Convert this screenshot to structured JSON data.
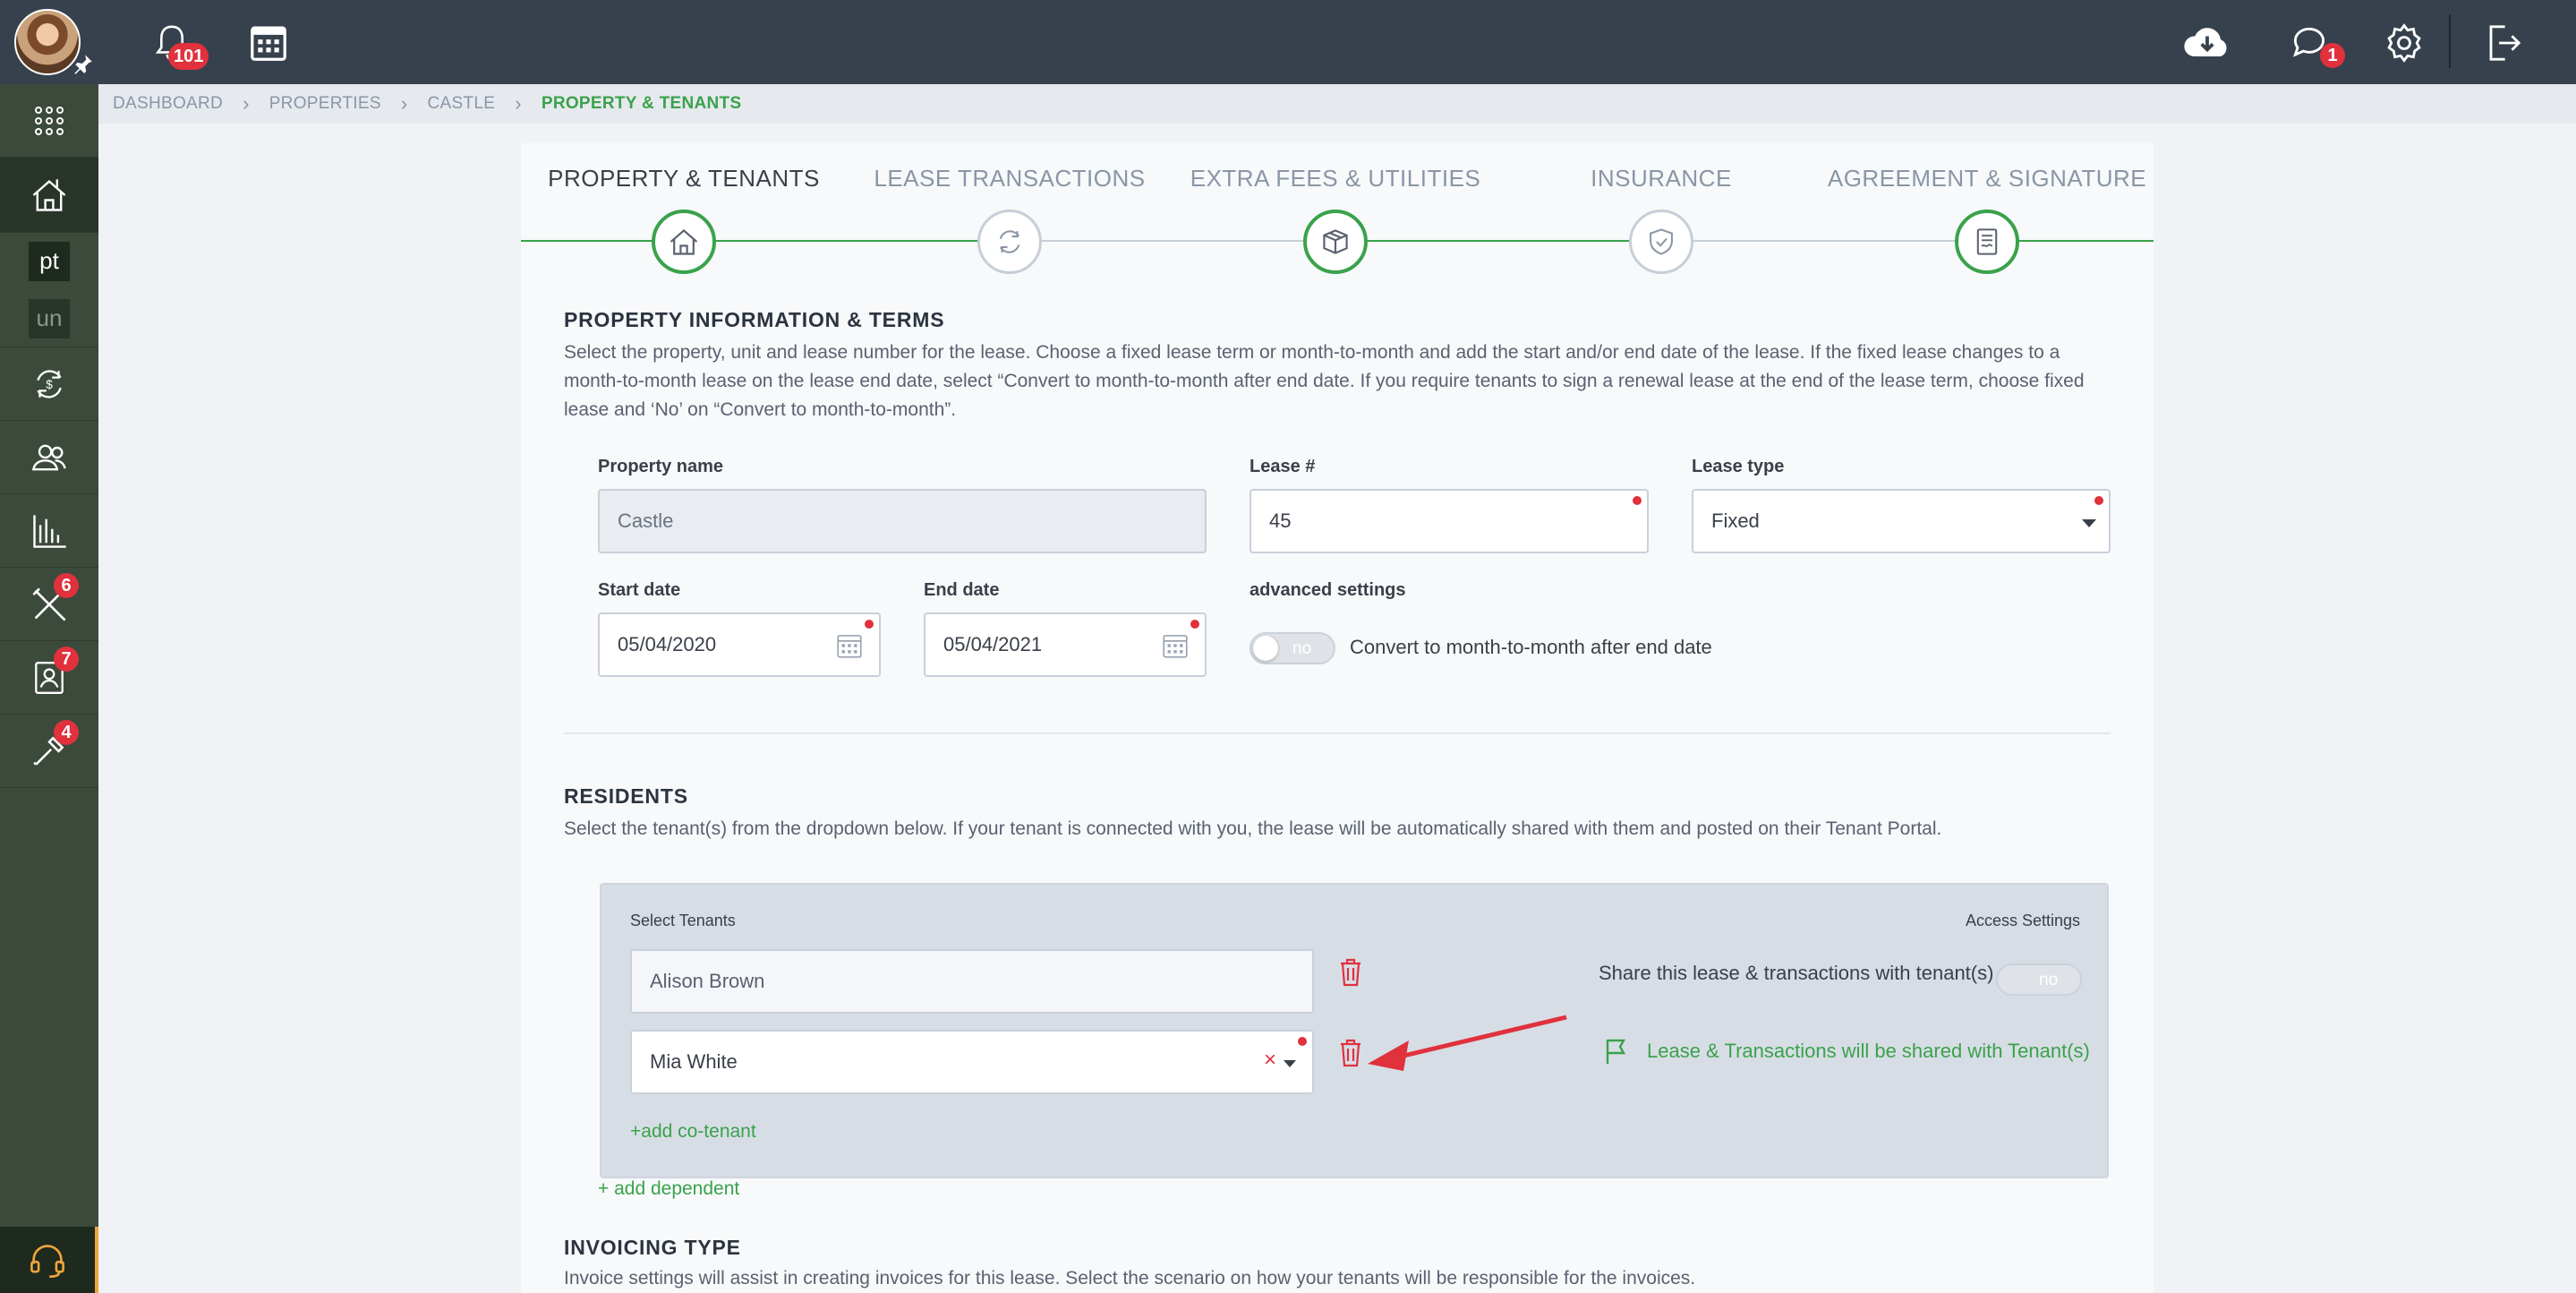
{
  "topbar": {
    "notifications_count": "101",
    "messages_count": "1",
    "icons": [
      "bell-icon",
      "calendar-icon",
      "cloud-download-icon",
      "chat-icon",
      "gear-icon",
      "logout-icon"
    ]
  },
  "sidebar": {
    "items": [
      {
        "icon": "apps-grid-icon"
      },
      {
        "icon": "properties-icon",
        "active": true
      },
      {
        "short": "pt"
      },
      {
        "short": "un"
      },
      {
        "icon": "transactions-icon"
      },
      {
        "icon": "tenants-icon"
      },
      {
        "icon": "reports-icon"
      },
      {
        "icon": "maintenance-icon",
        "badge": "6"
      },
      {
        "icon": "applications-icon",
        "badge": "7"
      },
      {
        "icon": "tools-icon",
        "badge": "4"
      }
    ],
    "support_icon": "headset-icon"
  },
  "breadcrumb": {
    "items": [
      "DASHBOARD",
      "PROPERTIES",
      "CASTLE"
    ],
    "current": "PROPERTY & TENANTS"
  },
  "steps": [
    {
      "label": "PROPERTY & TENANTS",
      "done": true,
      "active": true
    },
    {
      "label": "LEASE TRANSACTIONS",
      "done": false
    },
    {
      "label": "EXTRA FEES & UTILITIES",
      "done": true
    },
    {
      "label": "INSURANCE",
      "done": false
    },
    {
      "label": "AGREEMENT & SIGNATURE",
      "done": true
    }
  ],
  "property_section": {
    "title": "PROPERTY INFORMATION & TERMS",
    "description": "Select the property, unit and lease number for the lease. Choose a fixed lease term or month-to-month and add the start and/or end date of the lease. If the fixed lease changes to a month-to-month lease on the lease end date, select “Convert to month-to-month after end date. If you require tenants to sign a renewal lease at the end of the lease term, choose fixed lease and ‘No’ on “Convert to month-to-month”.",
    "property_name_label": "Property name",
    "property_name_value": "Castle",
    "lease_no_label": "Lease #",
    "lease_no_value": "45",
    "lease_type_label": "Lease type",
    "lease_type_value": "Fixed",
    "start_date_label": "Start date",
    "start_date_value": "05/04/2020",
    "end_date_label": "End date",
    "end_date_value": "05/04/2021",
    "advanced_label": "advanced settings",
    "convert_toggle_text": "no",
    "convert_label": "Convert to month-to-month after end date"
  },
  "residents_section": {
    "title": "RESIDENTS",
    "description": "Select the tenant(s) from the dropdown below. If your tenant is connected with you, the lease will be automatically shared with them and posted on their Tenant Portal.",
    "select_tenants_label": "Select Tenants",
    "access_settings_label": "Access Settings",
    "tenants": [
      "Alison Brown",
      "Mia White"
    ],
    "share_label": "Share this lease & transactions with tenant(s)",
    "share_toggle_text": "no",
    "shared_message": "Lease & Transactions will be shared with Tenant(s)",
    "add_cotenant": "+add co-tenant",
    "add_dependent": "+ add dependent"
  },
  "invoicing_section": {
    "title": "INVOICING TYPE",
    "description": "Invoice settings will assist in creating invoices for this lease. Select the scenario on how your tenants will be responsible for the invoices."
  },
  "colors": {
    "accent_green": "#3aa24b",
    "topbar": "#36414d",
    "sidebar": "#3c4a3c",
    "badge_red": "#e0313d"
  }
}
